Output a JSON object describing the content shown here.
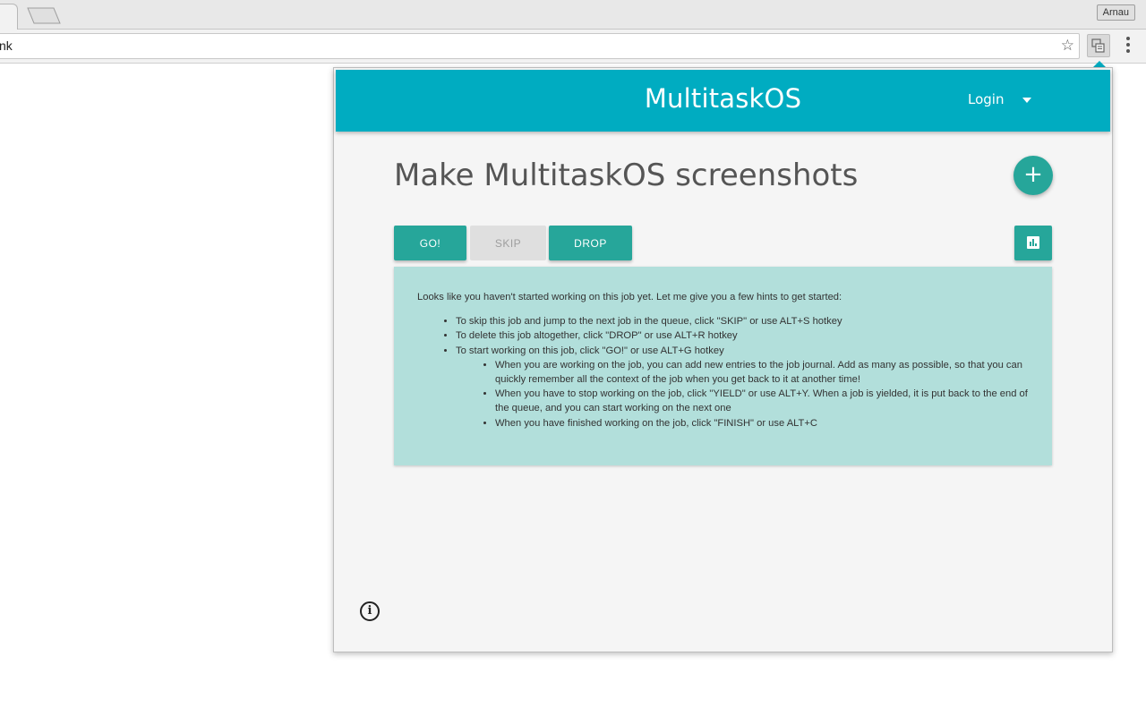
{
  "browser": {
    "tab_close_glyph": "×",
    "profile_name": "Arnau",
    "address_text": "nk",
    "star_glyph": "☆"
  },
  "app": {
    "title": "MultitaskOS",
    "login_label": "Login",
    "accent_color": "#00acc1",
    "primary_color": "#26a69a"
  },
  "job": {
    "title": "Make MultitaskOS screenshots",
    "add_glyph": "+"
  },
  "actions": {
    "go_label": "GO!",
    "skip_label": "SKIP",
    "drop_label": "DROP",
    "stats_icon": "bar-chart-icon"
  },
  "hints": {
    "intro": "Looks like you haven't started working on this job yet. Let me give you a few hints to get started:",
    "items": [
      "To skip this job and jump to the next job in the queue, click \"SKIP\" or use ALT+S hotkey",
      "To delete this job altogether, click \"DROP\" or use ALT+R hotkey",
      "To start working on this job, click \"GO!\" or use ALT+G hotkey"
    ],
    "subitems": [
      "When you are working on the job, you can add new entries to the job journal. Add as many as possible, so that you can quickly remember all the context of the job when you get back to it at another time!",
      "When you have to stop working on the job, click \"YIELD\" or use ALT+Y. When a job is yielded, it is put back to the end of the queue, and you can start working on the next one",
      "When you have finished working on the job, click \"FINISH\" or use ALT+C"
    ]
  },
  "footer": {
    "info_glyph": "i"
  }
}
